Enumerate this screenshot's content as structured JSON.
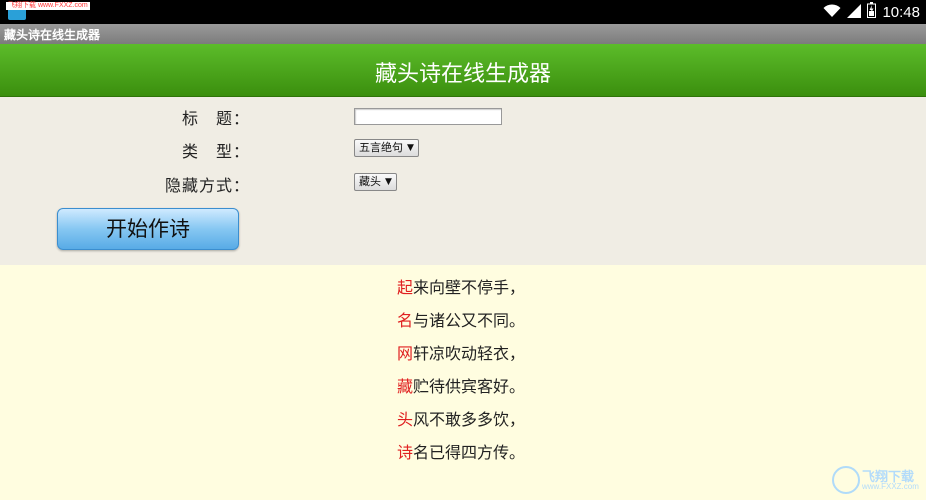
{
  "status_bar": {
    "source_badge": "飞翔下载 www.FXXZ.com",
    "time": "10:48",
    "icons": [
      "wifi-icon",
      "signal-icon",
      "battery-icon"
    ]
  },
  "title_bar": {
    "text": "藏头诗在线生成器"
  },
  "header": {
    "title": "藏头诗在线生成器"
  },
  "form": {
    "title_label": "标　题：",
    "title_value": "",
    "type_label": "类　型：",
    "type_selected": "五言绝句",
    "hide_label": "隐藏方式：",
    "hide_selected": "藏头",
    "start_button": "开始作诗"
  },
  "poem": {
    "lines": [
      {
        "head": "起",
        "rest": "来向壁不停手，"
      },
      {
        "head": "名",
        "rest": "与诸公又不同。"
      },
      {
        "head": "网",
        "rest": "轩凉吹动轻衣，"
      },
      {
        "head": "藏",
        "rest": "贮待供宾客好。"
      },
      {
        "head": "头",
        "rest": "风不敢多多饮，"
      },
      {
        "head": "诗",
        "rest": "名已得四方传。"
      }
    ],
    "head_color": "#e02020"
  },
  "watermark": {
    "text": "飞翔下载",
    "url": "www.FXXZ.com"
  },
  "colors": {
    "header_green": "#4ca51c",
    "button_blue": "#86c7f2",
    "poem_bg": "#fffde0",
    "form_bg": "#f0ede4"
  }
}
